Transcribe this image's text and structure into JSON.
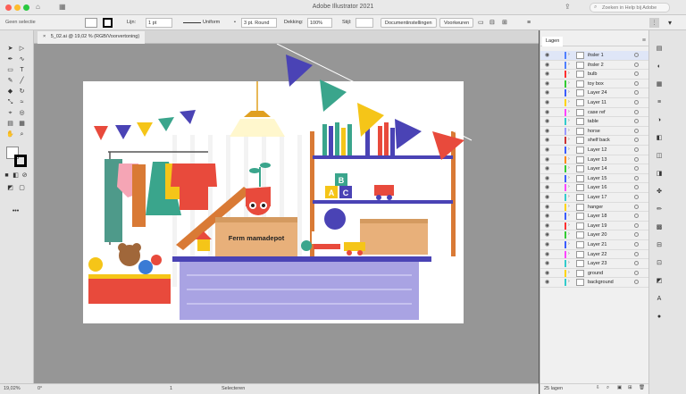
{
  "titlebar": {
    "title": "Adobe Illustrator 2021",
    "search_placeholder": "Zoeken in Help bij Adobe"
  },
  "controlbar": {
    "selection": "Geen selectie",
    "stroke_label": "Lijn:",
    "stroke_weight": "1 pt",
    "profile_value": "Uniform",
    "brush_value": "3 pt. Round",
    "opacity_label": "Dekking:",
    "opacity_value": "100%",
    "style_label": "Stijl:",
    "document_setup_button": "Documentinstellingen",
    "preferences_button": "Voorkeuren"
  },
  "document": {
    "tab_title": "5_02.ai @ 19,02 % (RGB/Voorvertoning)"
  },
  "artwork": {
    "box_label": "Ferm mamadepot",
    "block_letters": [
      "A",
      "B",
      "C"
    ]
  },
  "statusbar": {
    "zoom": "19,02%",
    "rotation": "0°",
    "artboard_number": "1",
    "tool_status": "Selecteren"
  },
  "layers_panel": {
    "tab_label": "Lagen",
    "layers": [
      {
        "name": "ihsler 1",
        "color": "#4f7fff"
      },
      {
        "name": "ihsler 2",
        "color": "#4f7fff"
      },
      {
        "name": "bulb",
        "color": "#ff3030"
      },
      {
        "name": "toy box",
        "color": "#33cc33"
      },
      {
        "name": "Layer 24",
        "color": "#3b5cff"
      },
      {
        "name": "Layer 11",
        "color": "#ffd400"
      },
      {
        "name": "case ref",
        "color": "#ff44ff"
      },
      {
        "name": "table",
        "color": "#33cccc"
      },
      {
        "name": "horse",
        "color": "#9999ff"
      },
      {
        "name": "shelf back",
        "color": "#cc3333"
      },
      {
        "name": "Layer 12",
        "color": "#3b5cff"
      },
      {
        "name": "Layer 13",
        "color": "#ff8800"
      },
      {
        "name": "Layer 14",
        "color": "#33cc33"
      },
      {
        "name": "Layer 15",
        "color": "#3b5cff"
      },
      {
        "name": "Layer 16",
        "color": "#ff44ff"
      },
      {
        "name": "Layer 17",
        "color": "#33cccc"
      },
      {
        "name": "hanger",
        "color": "#ffd400"
      },
      {
        "name": "Layer 18",
        "color": "#3b5cff"
      },
      {
        "name": "Layer 19",
        "color": "#ff3030"
      },
      {
        "name": "Layer 20",
        "color": "#33cc33"
      },
      {
        "name": "Layer 21",
        "color": "#3b5cff"
      },
      {
        "name": "Layer 22",
        "color": "#ff44ff"
      },
      {
        "name": "Layer 23",
        "color": "#33cccc"
      },
      {
        "name": "ground",
        "color": "#ffd400"
      },
      {
        "name": "background",
        "color": "#33cccc"
      }
    ],
    "footer_count": "25 lagen"
  }
}
